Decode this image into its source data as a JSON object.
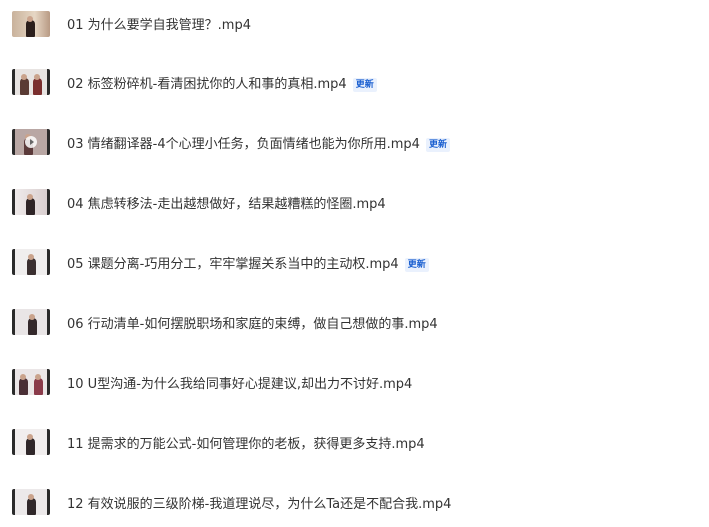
{
  "files": [
    {
      "title": "01 为什么要学自我管理？.mp4",
      "badge": ""
    },
    {
      "title": "02 标签粉碎机-看清困扰你的人和事的真相.mp4",
      "badge": "更新"
    },
    {
      "title": "03 情绪翻译器-4个心理小任务，负面情绪也能为你所用.mp4",
      "badge": "更新"
    },
    {
      "title": "04 焦虑转移法-走出越想做好，结果越糟糕的怪圈.mp4",
      "badge": ""
    },
    {
      "title": "05 课题分离-巧用分工，牢牢掌握关系当中的主动权.mp4",
      "badge": "更新"
    },
    {
      "title": "06 行动清单-如何摆脱职场和家庭的束缚，做自己想做的事.mp4",
      "badge": ""
    },
    {
      "title": "10 U型沟通-为什么我给同事好心提建议,却出力不讨好.mp4",
      "badge": ""
    },
    {
      "title": "11 提需求的万能公式-如何管理你的老板，获得更多支持.mp4",
      "badge": ""
    },
    {
      "title": "12 有效说服的三级阶梯-我道理说尽，为什么Ta还是不配合我.mp4",
      "badge": ""
    }
  ],
  "colors": {
    "text": "#333333",
    "badge_text": "#1a5fd0",
    "badge_bg": "#eaf1fd"
  },
  "icons": {
    "thumbnail": "video-thumbnail-icon",
    "play": "play-icon"
  }
}
